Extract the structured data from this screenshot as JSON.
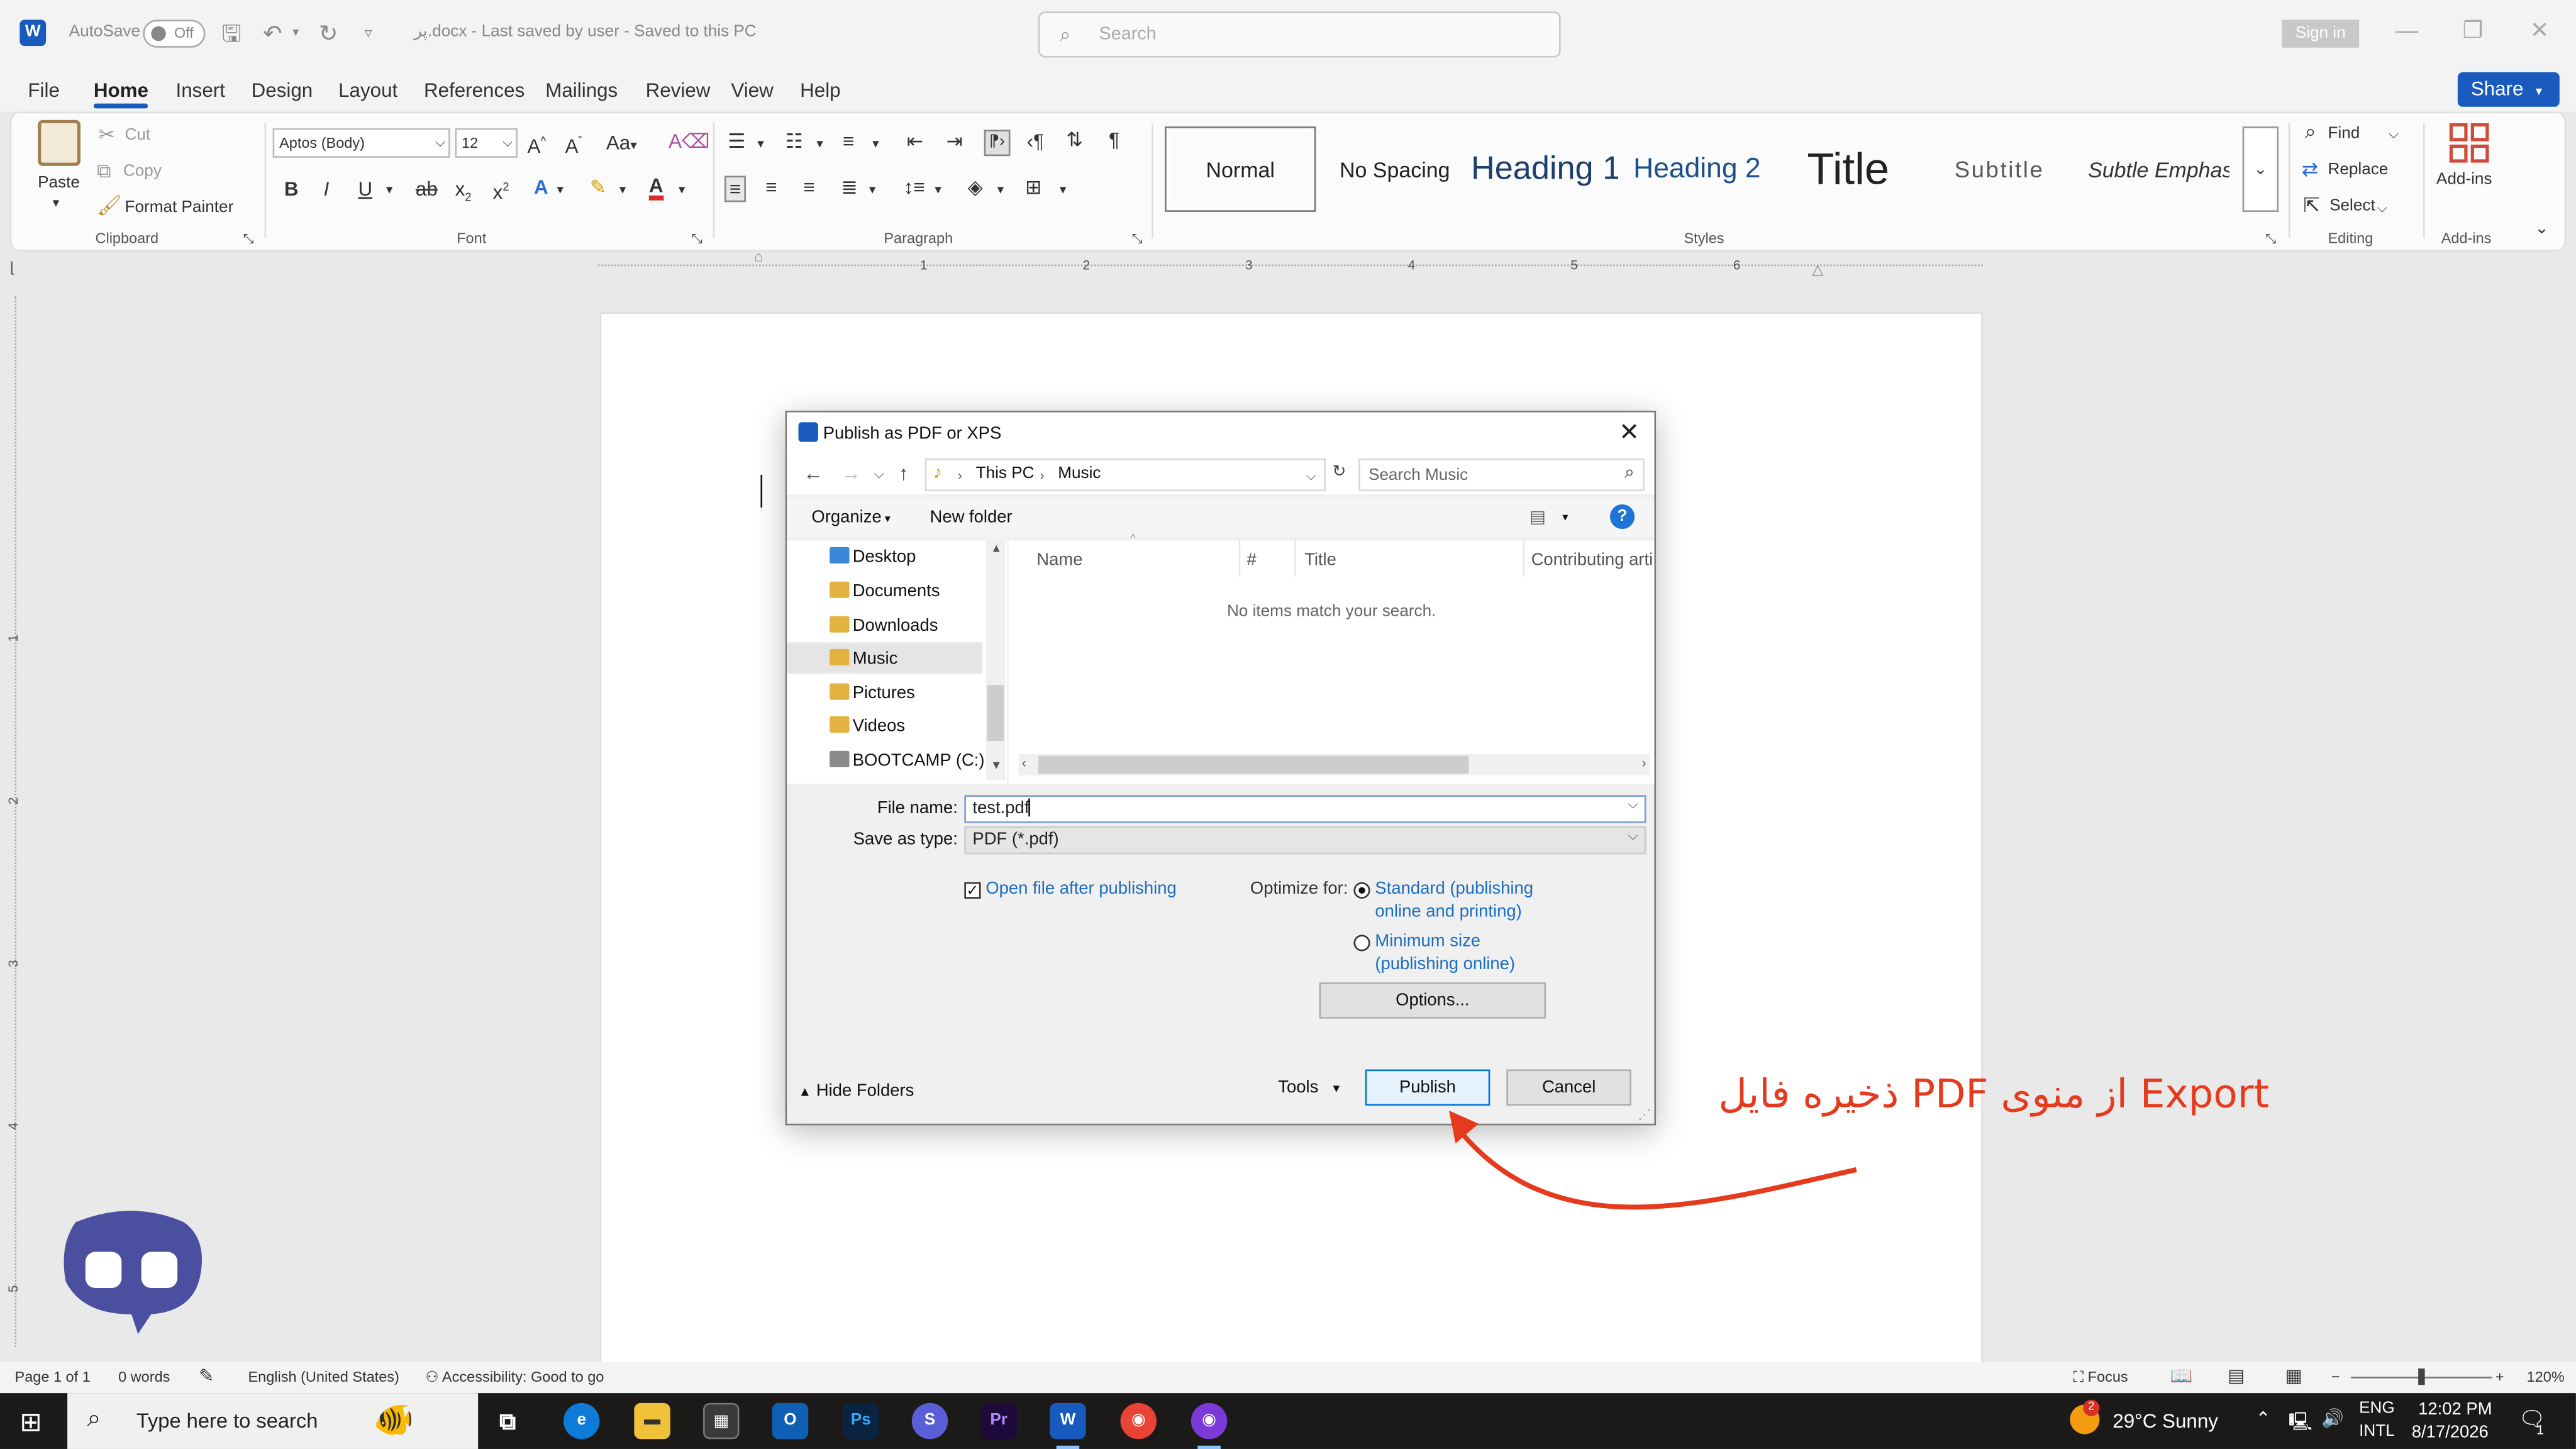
{
  "titlebar": {
    "autosave_label": "AutoSave",
    "autosave_state": "Off",
    "doc_status": "پر.docx  -  Last saved by user  -  Saved to this PC",
    "search_placeholder": "Search",
    "sign_in": "Sign in"
  },
  "menu": {
    "tabs": [
      "File",
      "Home",
      "Insert",
      "Design",
      "Layout",
      "References",
      "Mailings",
      "Review",
      "View",
      "Help"
    ],
    "active_tab": "Home",
    "share": "Share"
  },
  "ribbon": {
    "clipboard": {
      "label": "Clipboard",
      "paste": "Paste",
      "cut": "Cut",
      "copy": "Copy",
      "format_painter": "Format Painter"
    },
    "font": {
      "label": "Font",
      "font_name": "Aptos (Body)",
      "font_size": "12"
    },
    "paragraph": {
      "label": "Paragraph"
    },
    "styles": {
      "label": "Styles",
      "items": [
        "Normal",
        "No Spacing",
        "Heading 1",
        "Heading 2",
        "Title",
        "Subtitle",
        "Subtle Emphasis"
      ]
    },
    "editing": {
      "label": "Editing",
      "find": "Find",
      "replace": "Replace",
      "select": "Select"
    },
    "addins": {
      "label": "Add-ins",
      "button": "Add-ins"
    }
  },
  "ruler": {
    "numbers": [
      "1",
      "2",
      "3",
      "4",
      "5",
      "6"
    ],
    "v_numbers": [
      "1",
      "2",
      "3",
      "4",
      "5"
    ]
  },
  "dialog": {
    "title": "Publish as PDF or XPS",
    "path": [
      "This PC",
      "Music"
    ],
    "search_placeholder": "Search Music",
    "organize": "Organize",
    "new_folder": "New folder",
    "help": "?",
    "nav_items": [
      "Desktop",
      "Documents",
      "Downloads",
      "Music",
      "Pictures",
      "Videos",
      "BOOTCAMP (C:)"
    ],
    "selected_nav": "Music",
    "columns": [
      "Name",
      "#",
      "Title",
      "Contributing arti"
    ],
    "empty_message": "No items match your search.",
    "file_name_label": "File name:",
    "file_name_value": "test.pdf",
    "save_type_label": "Save as type:",
    "save_type_value": "PDF (*.pdf)",
    "open_after": "Open file after publishing",
    "open_after_checked": true,
    "optimize_label": "Optimize for:",
    "opt_standard_1": "Standard (publishing",
    "opt_standard_2": "online and printing)",
    "opt_min_1": "Minimum size",
    "opt_min_2": "(publishing online)",
    "options_btn": "Options...",
    "hide_folders": "Hide Folders",
    "tools": "Tools",
    "publish": "Publish",
    "cancel": "Cancel"
  },
  "annotation": {
    "text": "ذخیره فایل PDF از منوی Export",
    "color": "#e53a1e"
  },
  "statusbar": {
    "page": "Page 1 of 1",
    "words": "0 words",
    "language": "English (United States)",
    "accessibility": "Accessibility: Good to go",
    "focus": "Focus",
    "zoom": "120%"
  },
  "taskbar": {
    "search_placeholder": "Type here to search",
    "weather": "29°C  Sunny",
    "weather_badge": "2",
    "lang_1": "ENG",
    "lang_2": "INTL",
    "time": "12:02 PM",
    "date": "8/17/2026",
    "notif_count": "1"
  }
}
